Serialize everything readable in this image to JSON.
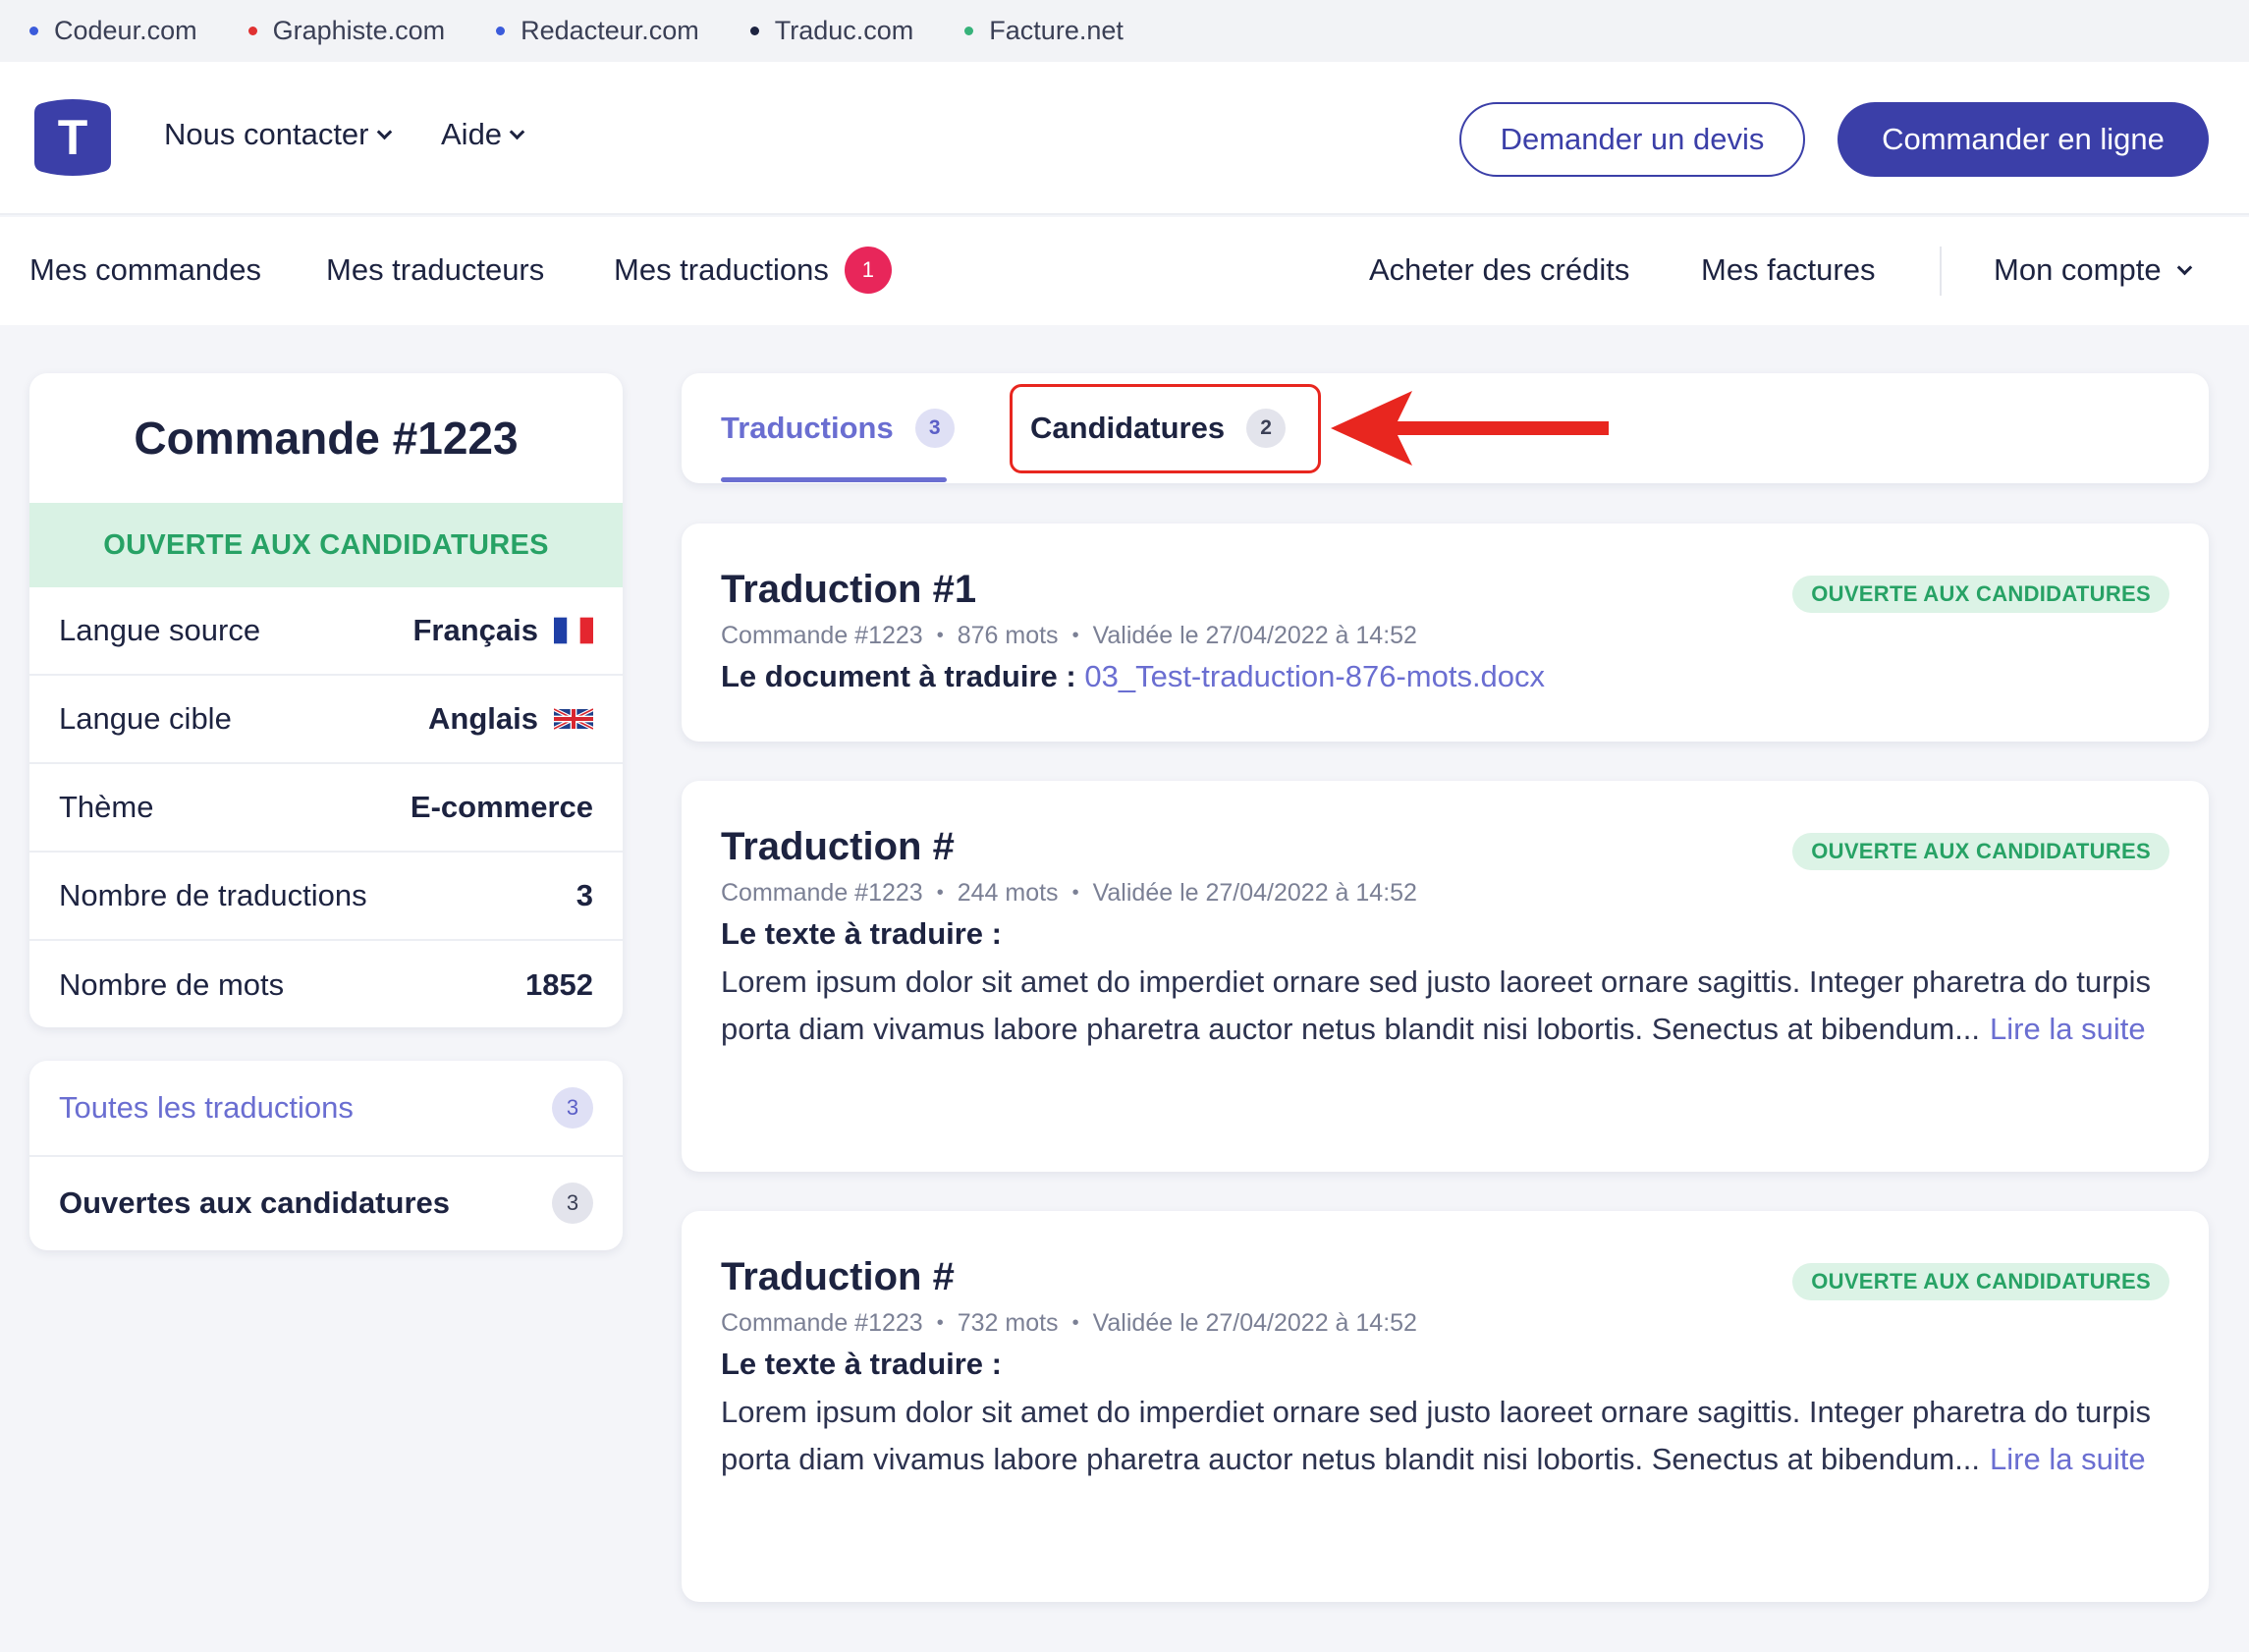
{
  "network": [
    {
      "label": "Codeur.com",
      "color": "#3b5bdb"
    },
    {
      "label": "Graphiste.com",
      "color": "#e03131"
    },
    {
      "label": "Redacteur.com",
      "color": "#3b5bdb"
    },
    {
      "label": "Traduc.com",
      "color": "#1d2340"
    },
    {
      "label": "Facture.net",
      "color": "#37b27a"
    }
  ],
  "header": {
    "logo_letter": "T",
    "contact_label": "Nous contacter",
    "help_label": "Aide",
    "quote_button": "Demander un devis",
    "order_button": "Commander en ligne"
  },
  "subnav": {
    "orders": "Mes commandes",
    "translators": "Mes traducteurs",
    "translations": "Mes traductions",
    "translations_badge": "1",
    "buy_credits": "Acheter des crédits",
    "invoices": "Mes factures",
    "account": "Mon compte"
  },
  "order": {
    "title": "Commande #1223",
    "status": "OUVERTE AUX CANDIDATURES",
    "rows": [
      {
        "label": "Langue source",
        "value": "Français",
        "flag": "fr"
      },
      {
        "label": "Langue cible",
        "value": "Anglais",
        "flag": "uk"
      },
      {
        "label": "Thème",
        "value": "E-commerce"
      },
      {
        "label": "Nombre de traductions",
        "value": "3"
      },
      {
        "label": "Nombre de mots",
        "value": "1852"
      }
    ]
  },
  "filters": [
    {
      "label": "Toutes les traductions",
      "count": "3"
    },
    {
      "label": "Ouvertes aux candidatures",
      "count": "3"
    }
  ],
  "tabs": [
    {
      "label": "Traductions",
      "count": "3"
    },
    {
      "label": "Candidatures",
      "count": "2"
    }
  ],
  "translations": [
    {
      "title": "Traduction #1",
      "status": "OUVERTE AUX CANDIDATURES",
      "order": "Commande #1223",
      "words": "876 mots",
      "validated": "Validée le 27/04/2022 à 14:52",
      "doc_label": "Le document à traduire :",
      "doc_link": "03_Test-traduction-876-mots.docx"
    },
    {
      "title": "Traduction #",
      "status": "OUVERTE AUX CANDIDATURES",
      "order": "Commande #1223",
      "words": "244 mots",
      "validated": "Validée le 27/04/2022 à 14:52",
      "text_label": "Le texte à traduire :",
      "text": "Lorem ipsum dolor sit amet do imperdiet ornare sed justo laoreet ornare sagittis. Integer pharetra do turpis porta diam vivamus labore pharetra auctor netus blandit nisi lobortis. Senectus at bibendum...",
      "read_more": "Lire la suite"
    },
    {
      "title": "Traduction #",
      "status": "OUVERTE AUX CANDIDATURES",
      "order": "Commande #1223",
      "words": "732 mots",
      "validated": "Validée le 27/04/2022 à 14:52",
      "text_label": "Le texte à traduire :",
      "text": "Lorem ipsum dolor sit amet do imperdiet ornare sed justo laoreet ornare sagittis. Integer pharetra do turpis porta diam vivamus labore pharetra auctor netus blandit nisi lobortis. Senectus at bibendum...",
      "read_more": "Lire la suite"
    }
  ],
  "colors": {
    "brand": "#3b3fa8",
    "accent": "#6a6ed1",
    "status_green": "#27a265",
    "badge_red": "#e8265a",
    "annotation_red": "#e8261f"
  }
}
